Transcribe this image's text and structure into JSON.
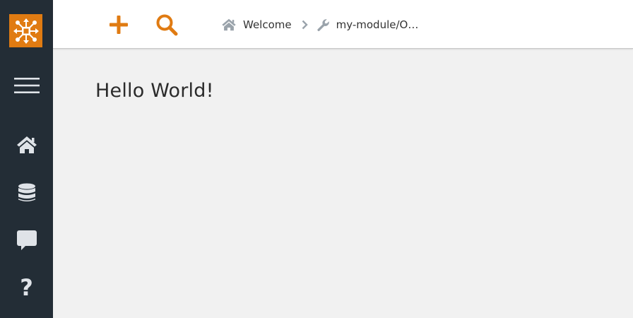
{
  "toolbar": {
    "add_icon": "plus-icon",
    "search_icon": "search-icon",
    "accent_color": "#e07b12"
  },
  "breadcrumb": {
    "items": [
      {
        "icon": "home-icon",
        "label": "Welcome"
      },
      {
        "icon": "wrench-icon",
        "label": "my-module/Op…"
      }
    ]
  },
  "sidebar": {
    "logo_icon": "app-logo-icon",
    "items": [
      {
        "icon": "hamburger-menu-icon"
      },
      {
        "icon": "home-icon"
      },
      {
        "icon": "database-icon"
      },
      {
        "icon": "chat-icon"
      },
      {
        "icon": "help-icon",
        "glyph": "?"
      }
    ],
    "background_color": "#232d36"
  },
  "main": {
    "title": "Hello World!"
  }
}
